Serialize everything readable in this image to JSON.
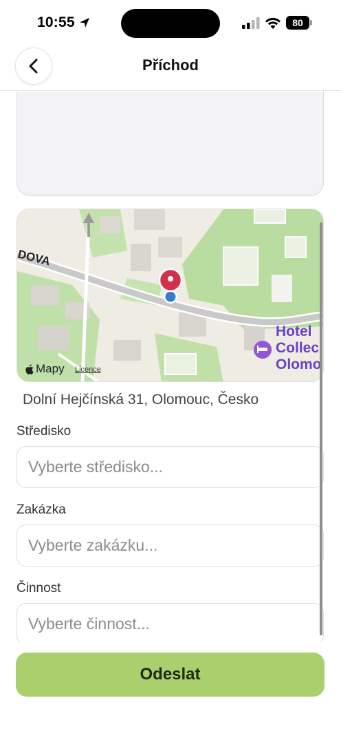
{
  "status_bar": {
    "time": "10:55",
    "battery": "80"
  },
  "nav": {
    "title": "Příchod"
  },
  "map": {
    "street_label": "DOVA",
    "poi_lines": [
      "Hotel",
      "Collec",
      "Olomo"
    ],
    "attribution": "Mapy",
    "licence": "Licence"
  },
  "address": "Dolní Hejčínská 31, Olomouc, Česko",
  "fields": {
    "stredisko": {
      "label": "Středisko",
      "placeholder": "Vyberte středisko..."
    },
    "zakazka": {
      "label": "Zakázka",
      "placeholder": "Vyberte zakázku..."
    },
    "cinnost": {
      "label": "Činnost",
      "placeholder": "Vyberte činnost..."
    }
  },
  "submit": {
    "label": "Odeslat"
  },
  "colors": {
    "accent": "#a9d06d",
    "map_pin": "#d2304b",
    "poi": "#6b3fc8"
  }
}
